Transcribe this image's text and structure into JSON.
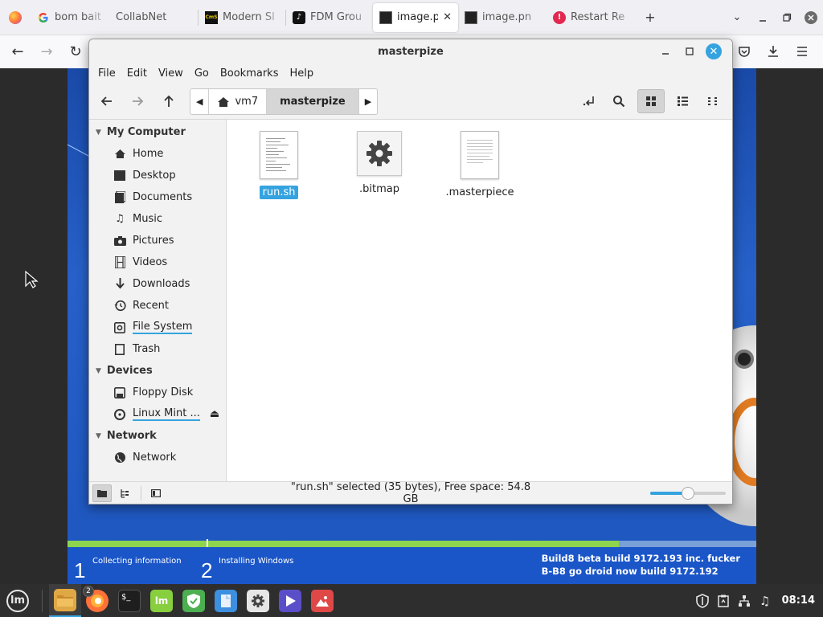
{
  "browser": {
    "tabs": [
      {
        "label": "bom bait",
        "favicon": "google-icon",
        "active": false
      },
      {
        "label": "CollabNet",
        "favicon": "none",
        "active": false
      },
      {
        "label": "Modern Sl",
        "favicon": "modern-site-icon",
        "active": false
      },
      {
        "label": "FDM Grou",
        "favicon": "tiktok-icon",
        "active": false
      },
      {
        "label": "image.p",
        "favicon": "image-icon",
        "active": true
      },
      {
        "label": "image.pn",
        "favicon": "image-icon",
        "active": false
      },
      {
        "label": "Restart Re",
        "favicon": "alert-icon",
        "active": false
      }
    ],
    "accent": "#35a3df"
  },
  "file_manager": {
    "title": "masterpize",
    "menu": [
      "File",
      "Edit",
      "View",
      "Go",
      "Bookmarks",
      "Help"
    ],
    "breadcrumb": {
      "home": "vm7",
      "current": "masterpize"
    },
    "sidebar": {
      "sections": [
        {
          "title": "My Computer",
          "items": [
            {
              "label": "Home",
              "icon": "home-icon"
            },
            {
              "label": "Desktop",
              "icon": "desktop-icon"
            },
            {
              "label": "Documents",
              "icon": "documents-icon"
            },
            {
              "label": "Music",
              "icon": "music-icon"
            },
            {
              "label": "Pictures",
              "icon": "camera-icon"
            },
            {
              "label": "Videos",
              "icon": "film-icon"
            },
            {
              "label": "Downloads",
              "icon": "download-icon"
            },
            {
              "label": "Recent",
              "icon": "history-icon"
            },
            {
              "label": "File System",
              "icon": "disk-icon"
            },
            {
              "label": "Trash",
              "icon": "trash-icon"
            }
          ]
        },
        {
          "title": "Devices",
          "items": [
            {
              "label": "Floppy Disk",
              "icon": "floppy-icon"
            },
            {
              "label": "Linux Mint ...",
              "icon": "optical-disc-icon"
            }
          ]
        },
        {
          "title": "Network",
          "items": [
            {
              "label": "Network",
              "icon": "globe-icon"
            }
          ]
        }
      ]
    },
    "files": [
      {
        "name": "run.sh",
        "type": "text",
        "selected": true
      },
      {
        "name": ".bitmap",
        "type": "settings",
        "selected": false
      },
      {
        "name": ".masterpiece",
        "type": "text",
        "selected": false
      }
    ],
    "status": "\"run.sh\" selected (35 bytes), Free space: 54.8 GB",
    "zoom_level": 0.5
  },
  "windows_setup": {
    "steps": [
      {
        "num": "1",
        "label": "Collecting information"
      },
      {
        "num": "2",
        "label": "Installing Windows"
      }
    ],
    "progress": 0.8,
    "build_line1": "Build8 beta build 9172.193 inc. fucker",
    "build_line2": "B-B8 go droid now build 9172.192"
  },
  "taskbar": {
    "apps": [
      {
        "name": "files",
        "color": "#e0a845"
      },
      {
        "name": "firefox",
        "color": "#ff7139",
        "badge": "2"
      },
      {
        "name": "terminal",
        "color": "#1e1e1e"
      },
      {
        "name": "mint-update",
        "color": "#87cf3e"
      },
      {
        "name": "shield",
        "color": "#4caf50"
      },
      {
        "name": "files-doc",
        "color": "#3d8fe0"
      },
      {
        "name": "settings",
        "color": "#e6e6e6"
      },
      {
        "name": "media-player",
        "color": "#5b4fc9"
      },
      {
        "name": "image-viewer",
        "color": "#e04848"
      }
    ],
    "clock": "08:14"
  }
}
